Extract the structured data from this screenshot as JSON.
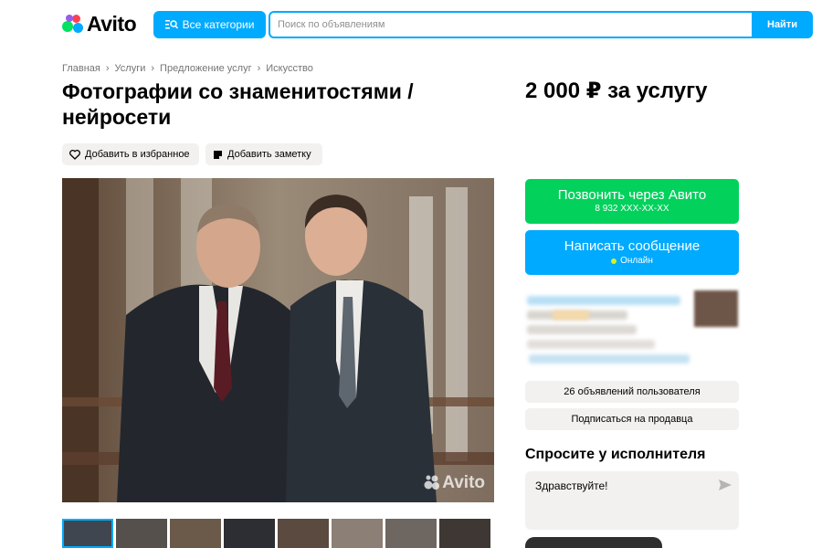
{
  "header": {
    "logo_text": "Avito",
    "categories_label": "Все категории",
    "search_placeholder": "Поиск по объявлениям",
    "find_label": "Найти"
  },
  "breadcrumbs": [
    "Главная",
    "Услуги",
    "Предложение услуг",
    "Искусство"
  ],
  "listing": {
    "title": "Фотографии со знаменитостями / нейросети",
    "price": "2 000 ₽ за услугу",
    "favorite_label": "Добавить в избранное",
    "note_label": "Добавить заметку",
    "watermark": "Avito"
  },
  "contact": {
    "call_label": "Позвонить через Авито",
    "call_phone": "8 932 XXX-XX-XX",
    "message_label": "Написать сообщение",
    "message_status": "Онлайн"
  },
  "seller": {
    "ads_count_label": "26 объявлений пользователя",
    "subscribe_label": "Подписаться на продавца"
  },
  "ask": {
    "title": "Спросите у исполнителя",
    "message_value": "Здравствуйте!"
  },
  "colors": {
    "brand_blue": "#00aaff",
    "call_green": "#02d15c",
    "chip_gray": "#f2f1f0"
  }
}
